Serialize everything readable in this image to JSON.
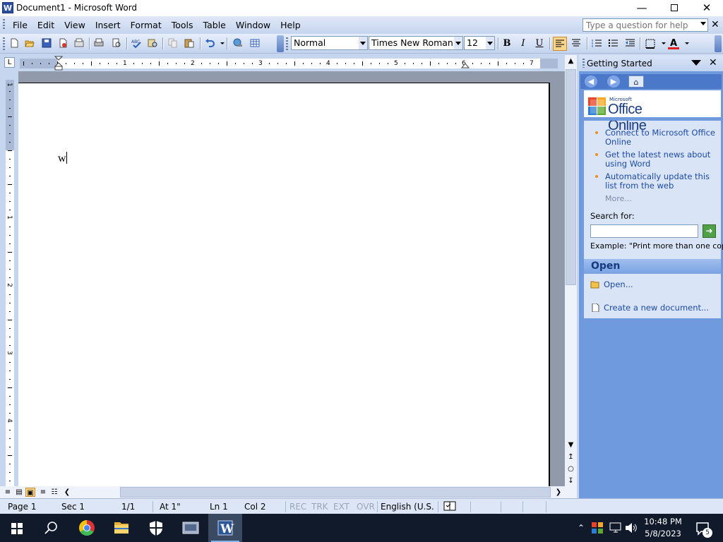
{
  "window": {
    "title": "Document1 - Microsoft Word",
    "app_icon_letter": "W"
  },
  "menu": {
    "items": [
      "File",
      "Edit",
      "View",
      "Insert",
      "Format",
      "Tools",
      "Table",
      "Window",
      "Help"
    ],
    "help_placeholder": "Type a question for help"
  },
  "toolbar": {
    "style": "Normal",
    "font": "Times New Roman",
    "size": "12",
    "bold": "B",
    "italic": "I",
    "underline": "U",
    "font_color": "#e02020",
    "highlight_active": "#f8d58b"
  },
  "ruler": {
    "numbers": [
      "1",
      "2",
      "3",
      "4",
      "5",
      "6",
      "7"
    ]
  },
  "document": {
    "text": "w"
  },
  "taskpane": {
    "title": "Getting Started",
    "logo_small": "Microsoft",
    "logo_text": "Office Online",
    "links": [
      "Connect to Microsoft Office Online",
      "Get the latest news about using Word",
      "Automatically update this list from the web"
    ],
    "more": "More...",
    "search_label": "Search for:",
    "example": "Example:  \"Print more than one copy\"",
    "open_title": "Open",
    "open_link": "Open...",
    "create_link": "Create a new document..."
  },
  "statusbar": {
    "page": "Page  1",
    "sec": "Sec  1",
    "pages": "1/1",
    "at": "At  1\"",
    "ln": "Ln  1",
    "col": "Col  2",
    "rec": "REC",
    "trk": "TRK",
    "ext": "EXT",
    "ovr": "OVR",
    "language": "English (U.S."
  },
  "taskbar": {
    "time": "10:48 PM",
    "date": "5/8/2023",
    "notification_count": "5"
  }
}
